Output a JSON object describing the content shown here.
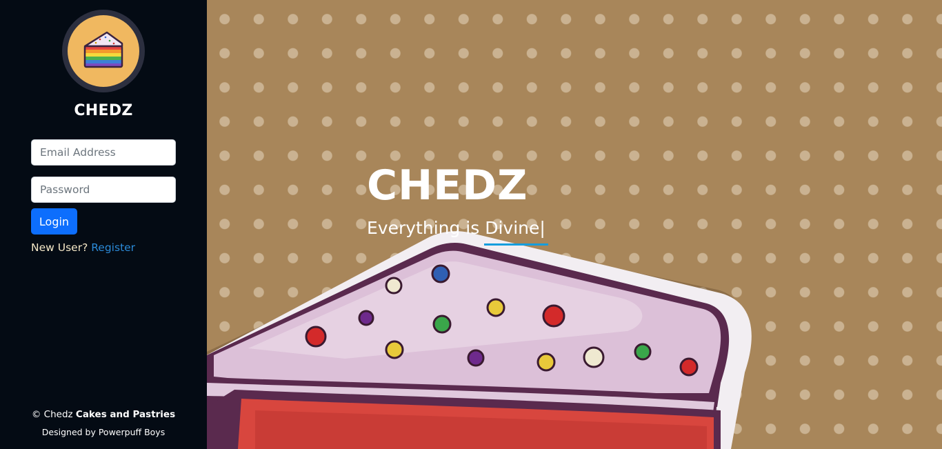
{
  "sidebar": {
    "brand_name": "CHEDZ",
    "logo_icon": "rainbow-cake-slice-icon",
    "email_placeholder": "Email Address",
    "password_placeholder": "Password",
    "login_label": "Login",
    "new_user_text": "New User?",
    "register_link": "Register",
    "footer": {
      "copyright_prefix": "© Chedz",
      "copyright_bold": "Cakes and Pastries",
      "designed_by": "Designed by Powerpuff Boys"
    }
  },
  "hero": {
    "title": "CHEDZ",
    "subtitle": "Everything is Divine",
    "cursor": "|",
    "background_image": "cake-slice-illustration"
  },
  "colors": {
    "sidebar_bg": "#040b14",
    "hero_bg": "#a8865a",
    "primary_button": "#0d6efd",
    "link": "#2b8ad8",
    "accent_underline": "#149ddd"
  }
}
